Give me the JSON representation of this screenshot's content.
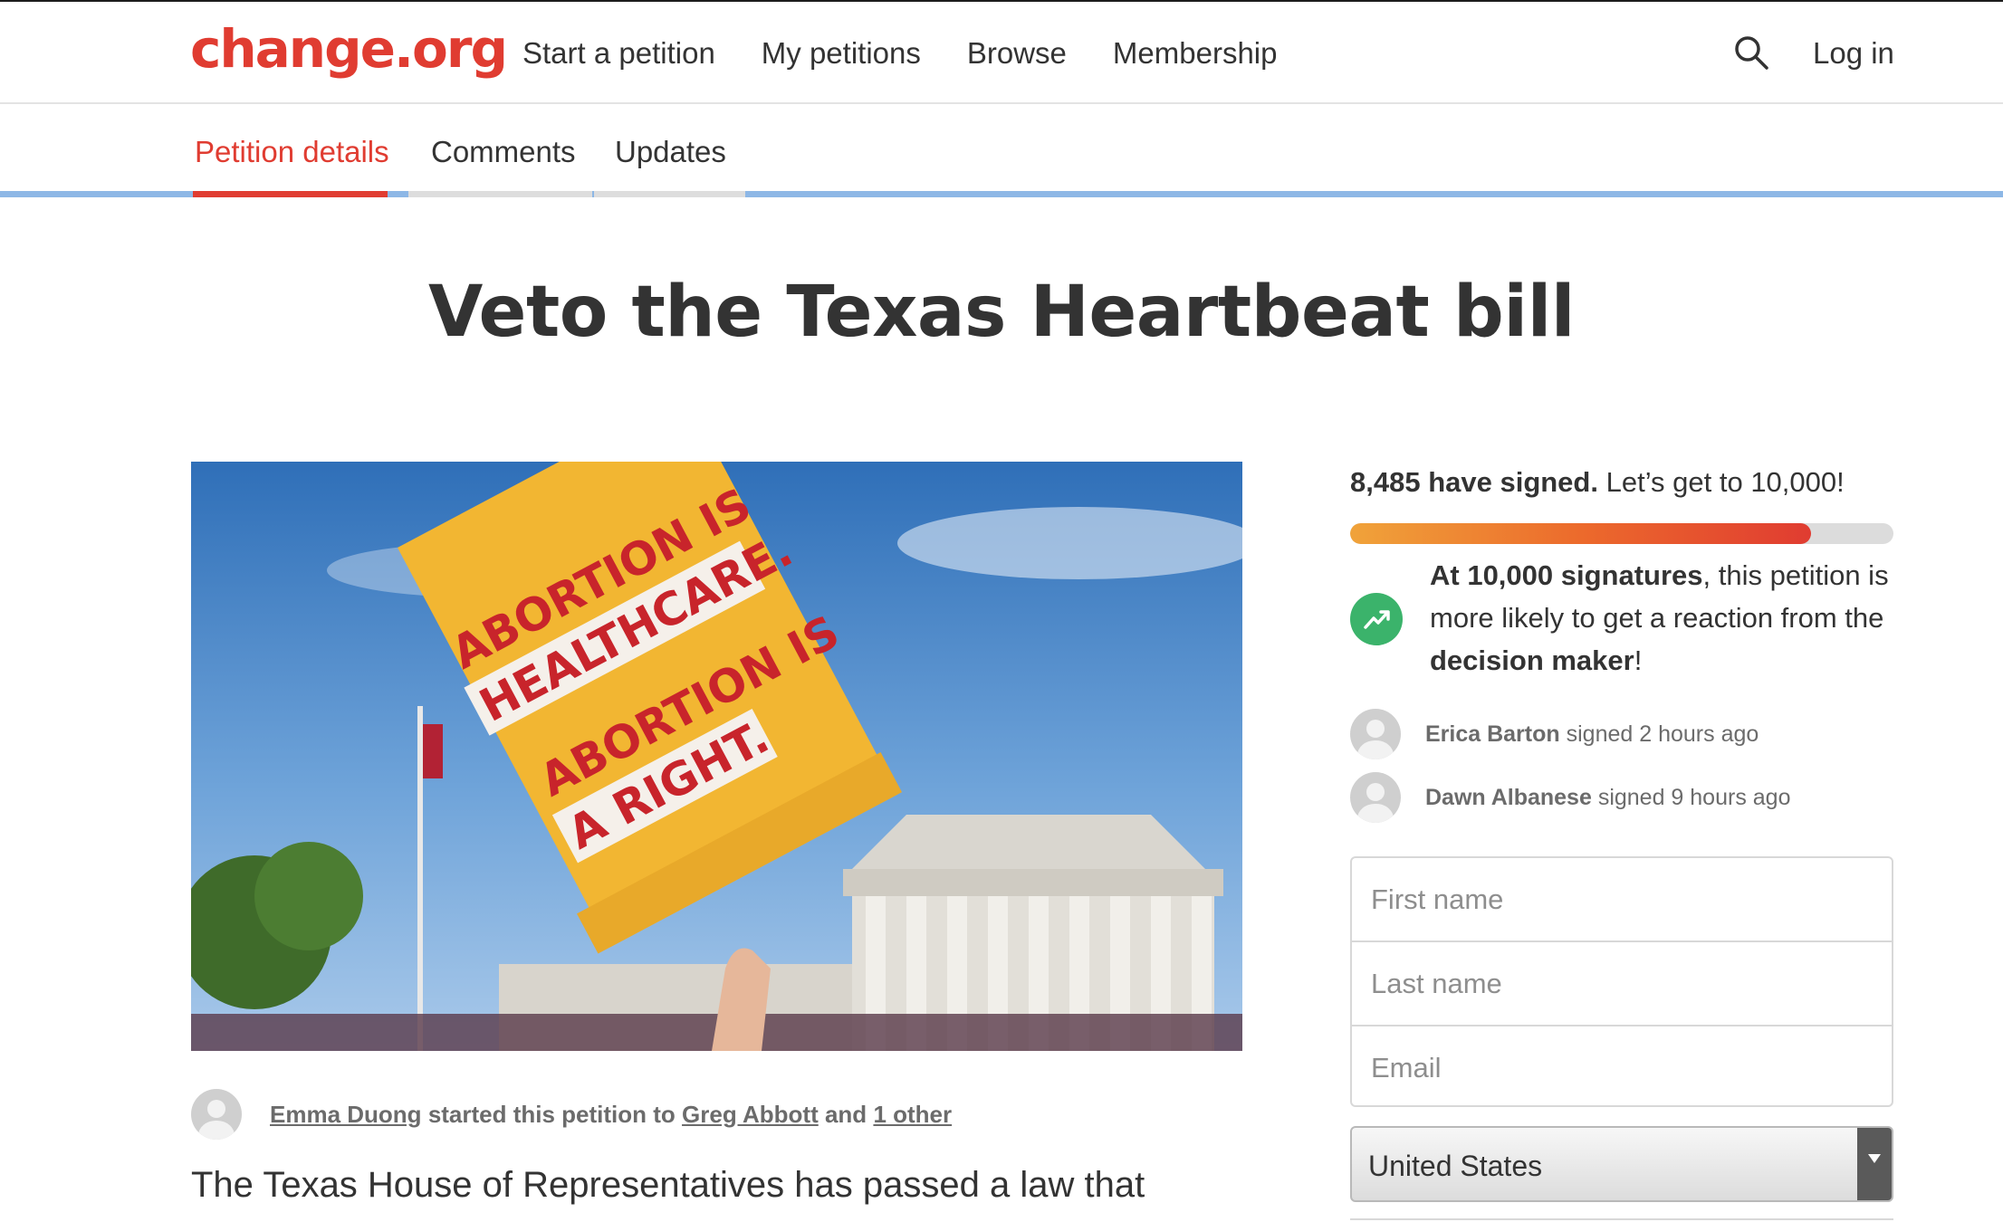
{
  "header": {
    "logo": "change.org",
    "nav": [
      "Start a petition",
      "My petitions",
      "Browse",
      "Membership"
    ],
    "login": "Log in"
  },
  "tabs": [
    "Petition details",
    "Comments",
    "Updates"
  ],
  "petition": {
    "title": "Veto the Texas Heartbeat bill",
    "image_sign": [
      "ABORTION IS",
      "HEALTHCARE.",
      "ABORTION IS",
      "A RIGHT."
    ],
    "starter": {
      "name": "Emma Duong",
      "middle": "started this petition to",
      "target": "Greg Abbott",
      "and": "and",
      "other": "1 other"
    },
    "description": "The Texas House of Representatives has passed a law that"
  },
  "sidebar": {
    "signed_count": "8,485 have signed.",
    "goal_text": "Let’s get to 10,000!",
    "progress_fraction": 0.8485,
    "milestone": {
      "bold_start": "At 10,000 signatures",
      "middle": ", this petition is more likely to get a reaction from the ",
      "bold_end": "decision maker",
      "end": "!"
    },
    "recent_signers": [
      {
        "name": "Erica Barton",
        "text": "signed 2 hours ago"
      },
      {
        "name": "Dawn Albanese",
        "text": "signed 9 hours ago"
      }
    ],
    "form": {
      "first_name_placeholder": "First name",
      "last_name_placeholder": "Last name",
      "email_placeholder": "Email"
    },
    "country": "United States"
  },
  "colors": {
    "brand_red": "#e03c31",
    "progress_start": "#f0a33a",
    "progress_end": "#e03c31",
    "trend_green": "#3bb36b",
    "tab_bar_blue": "#8db7e6"
  },
  "icons": {
    "search": "search-icon",
    "trend": "trending-up-icon",
    "avatar": "user-avatar-icon",
    "dropdown": "chevron-down-icon"
  }
}
